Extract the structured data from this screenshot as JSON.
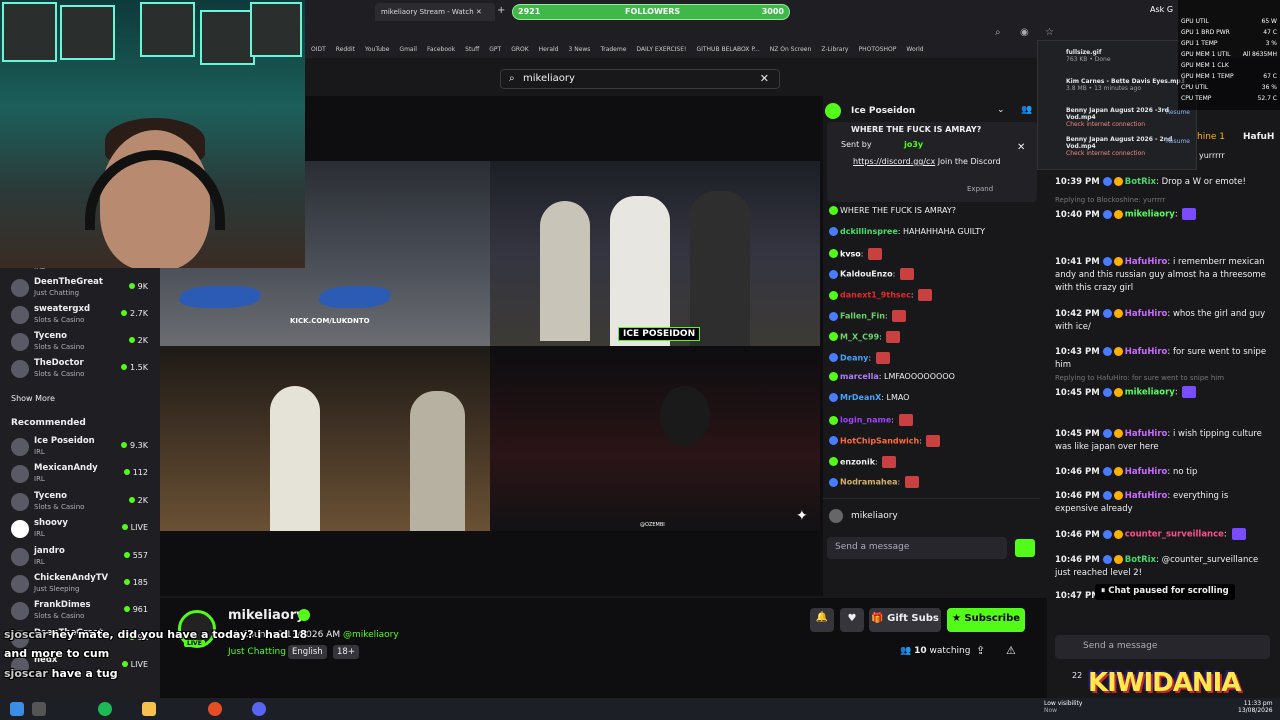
{
  "browser": {
    "tab_active": "mikeliaory Stream - Watch",
    "followers_goal": {
      "label": "FOLLOWERS",
      "current": "2921",
      "target": "3000",
      "progress": 0.97
    },
    "bookmarks": [
      "OIDT",
      "Reddit",
      "YouTube",
      "Gmail",
      "Facebook",
      "Stuff",
      "GPT",
      "GROK",
      "Herald",
      "3 News",
      "Trademe",
      "DAILY EXERCISE!",
      "GITHUB BELABOX P...",
      "NZ On Screen",
      "Z-Library",
      "PHOTOSHOP",
      "World"
    ],
    "ask_label": "Ask G"
  },
  "search": {
    "value": "mikeliaory"
  },
  "downloads": [
    {
      "name": "fullsize.gif",
      "status": "763 KB • Done"
    },
    {
      "name": "Kim Carnes - Bette Davis Eyes.mp3",
      "status": "3.8 MB • 13 minutes ago"
    },
    {
      "name": "Benny Japan August 2026 -3rd Vod.mp4",
      "status": "Check internet connection",
      "action": "Resume"
    },
    {
      "name": "Benny Japan August 2026 - 2nd Vod.mp4",
      "status": "Check internet connection",
      "action": "Resume"
    }
  ],
  "hwmon": {
    "rows": [
      {
        "label": "GPU UTIL",
        "value": "65 W"
      },
      {
        "label": "GPU 1 BRD PWR",
        "value": "47 C"
      },
      {
        "label": "GPU 1 TEMP",
        "value": "3 %"
      },
      {
        "label": "GPU MEM 1 UTIL",
        "value": "All 8635MH"
      },
      {
        "label": "GPU MEM 1 CLK",
        "value": ""
      },
      {
        "label": "GPU MEM 1 TEMP",
        "value": "67 C"
      },
      {
        "label": "CPU UTIL",
        "value": "36 %"
      },
      {
        "label": "CPU TEMP",
        "value": "52.7 C"
      }
    ]
  },
  "sidebar": {
    "top_channel_cat": "IRL",
    "followed": [
      {
        "name": "DeenTheGreat",
        "category": "Just Chatting",
        "viewers": "9K"
      },
      {
        "name": "sweatergxd",
        "category": "Slots & Casino",
        "viewers": "2.7K"
      },
      {
        "name": "Tyceno",
        "category": "Slots & Casino",
        "viewers": "2K"
      },
      {
        "name": "TheDoctor",
        "category": "Slots & Casino",
        "viewers": "1.5K"
      }
    ],
    "show_more": "Show More",
    "recommended_title": "Recommended",
    "recommended": [
      {
        "name": "Ice Poseidon",
        "category": "IRL",
        "viewers": "9.3K"
      },
      {
        "name": "MexicanAndy",
        "category": "IRL",
        "viewers": "112"
      },
      {
        "name": "Tyceno",
        "category": "Slots & Casino",
        "viewers": "2K"
      },
      {
        "name": "shoovy",
        "category": "IRL",
        "viewers": "LIVE"
      },
      {
        "name": "jandro",
        "category": "IRL",
        "viewers": "557"
      },
      {
        "name": "ChickenAndyTV",
        "category": "Just Sleeping",
        "viewers": "185"
      },
      {
        "name": "FrankDimes",
        "category": "Slots & Casino",
        "viewers": "961"
      },
      {
        "name": "DeenTheGreat",
        "category": "",
        "viewers": "9K"
      },
      {
        "name": "nedx",
        "category": "",
        "viewers": "LIVE"
      }
    ]
  },
  "video": {
    "watermark": "KICK.COM/LUKDNTO",
    "name_tag": "ICE POSEIDON",
    "cam_credit": "@OZEMBI"
  },
  "popchat": {
    "channel": "Ice Poseidon",
    "pinned_header": "WHERE THE FUCK IS AMRAY?",
    "pinned_sent_by": "Sent by",
    "pinned_user": "jo3y",
    "pinned_link": "https://discord.gg/cx",
    "pinned_text": "Join the Discord",
    "expand": "Expand",
    "messages": [
      {
        "user": "",
        "text": "WHERE THE FUCK IS AMRAY?",
        "color": "#ffffff"
      },
      {
        "user": "dckillinspree",
        "text": "HAHAHHAHA GUILTY",
        "color": "#45e06b"
      },
      {
        "user": "kvso",
        "text": "",
        "color": "#ffffff"
      },
      {
        "user": "KaldouEnzo",
        "text": "",
        "color": "#efeff1"
      },
      {
        "user": "danext1_9thsec",
        "text": "",
        "color": "#e02b2b"
      },
      {
        "user": "Fallen_Fin",
        "text": "",
        "color": "#6ad36a"
      },
      {
        "user": "M_X_C99",
        "text": "",
        "color": "#6ad36a"
      },
      {
        "user": "Deany",
        "text": "",
        "color": "#45a3ff"
      },
      {
        "user": "marcella",
        "text": "LMFAOOOOOOOO",
        "color": "#b07cff"
      },
      {
        "user": "MrDeanX",
        "text": "LMAO",
        "color": "#45a3ff"
      },
      {
        "user": "login_name",
        "text": "",
        "color": "#a040ff"
      },
      {
        "user": "HotChipSandwich",
        "text": "",
        "color": "#ff6a3a"
      },
      {
        "user": "enzonik",
        "text": "",
        "color": "#efeff1"
      },
      {
        "user": "Nodramahea",
        "text": "",
        "color": "#d3b06a"
      }
    ],
    "bottom_user": "mikeliaory",
    "send_placeholder": "Send a message"
  },
  "chat": {
    "header_user": "HafuH",
    "header_partial": "hine 1",
    "top_fragment": "yurrrrr",
    "messages": [
      {
        "time": "10:39 PM",
        "user": "BotRix",
        "color": "#4bd56b",
        "text": "Drop a W or emote!"
      },
      {
        "time": "10:40 PM",
        "user": "mikeliaory",
        "color": "#52ff5c",
        "text": "",
        "reply": "Replying to Blockoshine: yurrrrr"
      },
      {
        "time": "10:41 PM",
        "user": "HafuHiro",
        "color": "#c86cff",
        "text": "i rememberr mexican andy and this russian guy almost ha a threesome with this crazy girl"
      },
      {
        "time": "10:42 PM",
        "user": "HafuHiro",
        "color": "#c86cff",
        "text": "whos the girl and guy with ice/"
      },
      {
        "time": "10:43 PM",
        "user": "HafuHiro",
        "color": "#c86cff",
        "text": "for sure went to snipe him"
      },
      {
        "time": "10:45 PM",
        "user": "mikeliaory",
        "color": "#52ff5c",
        "text": "",
        "reply": "Replying to HafuHiro: for sure went to snipe him"
      },
      {
        "time": "10:45 PM",
        "user": "HafuHiro",
        "color": "#c86cff",
        "text": "i wish tipping culture was like japan over here"
      },
      {
        "time": "10:46 PM",
        "user": "HafuHiro",
        "color": "#c86cff",
        "text": "no tip"
      },
      {
        "time": "10:46 PM",
        "user": "HafuHiro",
        "color": "#c86cff",
        "text": "everything is expensive already"
      },
      {
        "time": "10:46 PM",
        "user": "counter_surveillance",
        "color": "#ff4d8a",
        "text": ""
      },
      {
        "time": "10:46 PM",
        "user": "BotRix",
        "color": "#4bd56b",
        "text": "@counter_surveillance just reached level 2!"
      },
      {
        "time": "10:47 PM",
        "user": "HafuHiro",
        "color": "#c86cff",
        "text": "going to"
      }
    ],
    "paused": "Chat paused for scrolling",
    "send_placeholder": "Send a message",
    "viewer_fragment": "22"
  },
  "channel": {
    "name": "mikeliaory",
    "title": "LA County 8/13/2026 AM",
    "handle": "@mikeliaory",
    "category": "Just Chatting",
    "tags": [
      "English",
      "18+"
    ],
    "live": "LIVE",
    "gift_subs": "Gift Subs",
    "subscribe": "Subscribe",
    "watching_count": "10",
    "watching_label": "watching"
  },
  "overlay_chat": [
    {
      "user": "sjoscar",
      "text": "hey mate, did you have a today? i had 18"
    },
    {
      "user": "",
      "text": "and more to cum"
    },
    {
      "user": "sjoscar",
      "text": "have a tug"
    }
  ],
  "overlay_partial_name": "DeenTheGreat",
  "brand_watermark": "KIWIDANIA",
  "taskbar": {
    "weather": "Low visibility",
    "weather_sub": "Now",
    "time": "11:33 pm",
    "date": "13/08/2026"
  }
}
